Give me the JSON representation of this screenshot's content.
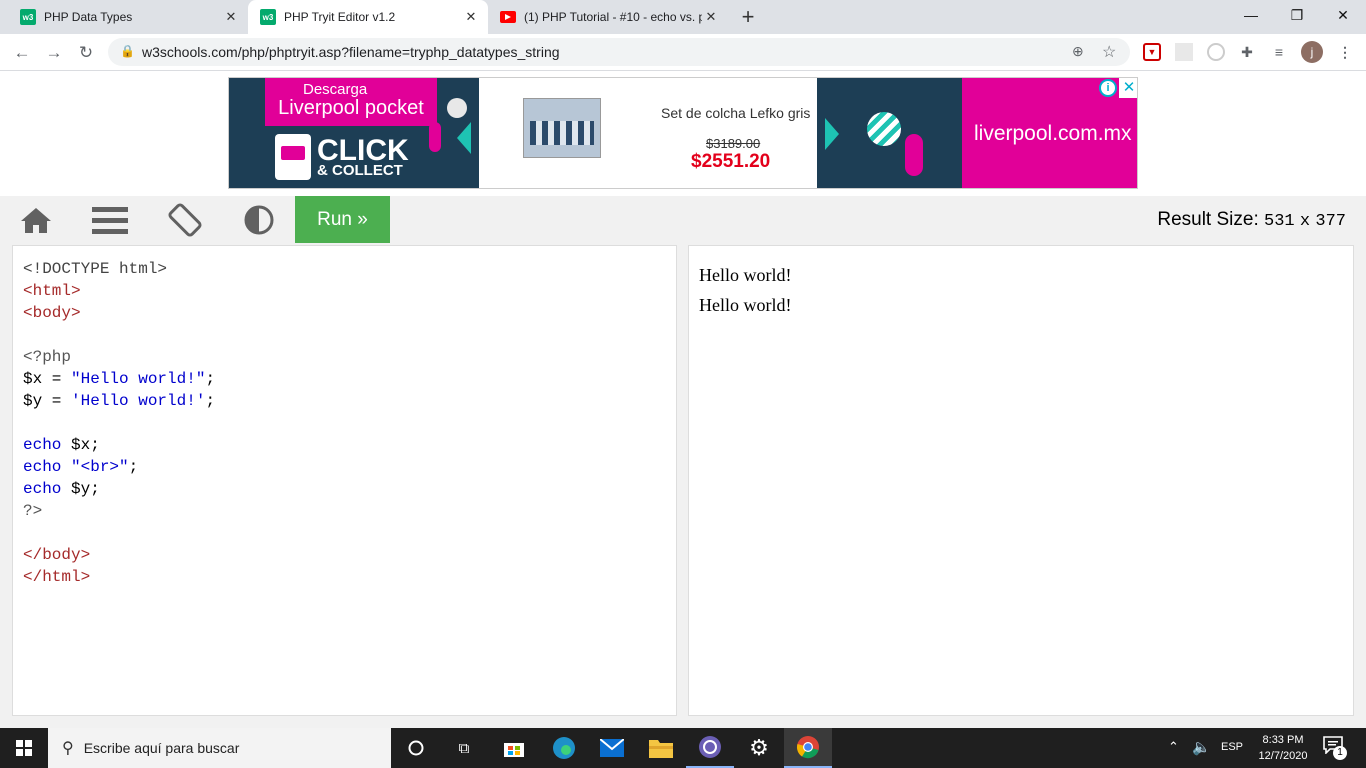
{
  "browser": {
    "tabs": [
      {
        "title": "PHP Data Types",
        "icon": "w3schools-icon"
      },
      {
        "title": "PHP Tryit Editor v1.2",
        "icon": "w3schools-icon"
      },
      {
        "title": "(1) PHP Tutorial - #10 - echo vs. p",
        "icon": "youtube-icon"
      }
    ],
    "new_tab": "+",
    "url": "w3schools.com/php/phptryit.asp?filename=tryphp_datatypes_string",
    "profile_initial": "j"
  },
  "ad": {
    "left_top": "Descarga",
    "left_brand": "Liverpool pocket",
    "left_click": "CLICK",
    "left_collect": "& COLLECT",
    "product_title": "Set de colcha Lefko gris",
    "old_price": "$3189.00",
    "new_price": "$2551.20",
    "domain": "liverpool.com.mx",
    "colors": {
      "navy": "#1d3e55",
      "pink": "#e10098",
      "price_red": "#e3001b"
    }
  },
  "w3toolbar": {
    "run_label": "Run »",
    "result_label": "Result Size:",
    "result_width": "531",
    "result_x": "x",
    "result_height": "377"
  },
  "editor": {
    "lines": [
      [
        {
          "t": "<!DOCTYPE html>",
          "c": "#444"
        }
      ],
      [
        {
          "t": "<html>",
          "c": "#a52a2a"
        }
      ],
      [
        {
          "t": "<body>",
          "c": "#a52a2a"
        }
      ],
      [
        {
          "t": "",
          "c": "#000"
        }
      ],
      [
        {
          "t": "<?php",
          "c": "#555"
        }
      ],
      [
        {
          "t": "$x",
          "c": "#000"
        },
        {
          "t": " = ",
          "c": "#000"
        },
        {
          "t": "\"Hello world!\"",
          "c": "#0000cd"
        },
        {
          "t": ";",
          "c": "#000"
        }
      ],
      [
        {
          "t": "$y",
          "c": "#000"
        },
        {
          "t": " = ",
          "c": "#000"
        },
        {
          "t": "'Hello world!'",
          "c": "#0000cd"
        },
        {
          "t": ";",
          "c": "#000"
        }
      ],
      [
        {
          "t": "",
          "c": "#000"
        }
      ],
      [
        {
          "t": "echo",
          "c": "#0000cd"
        },
        {
          "t": " $x;",
          "c": "#000"
        }
      ],
      [
        {
          "t": "echo",
          "c": "#0000cd"
        },
        {
          "t": " ",
          "c": "#000"
        },
        {
          "t": "\"<br>\"",
          "c": "#0000cd"
        },
        {
          "t": ";",
          "c": "#000"
        }
      ],
      [
        {
          "t": "echo",
          "c": "#0000cd"
        },
        {
          "t": " $y;",
          "c": "#000"
        }
      ],
      [
        {
          "t": "?>",
          "c": "#555"
        }
      ],
      [
        {
          "t": "",
          "c": "#000"
        }
      ],
      [
        {
          "t": "</body>",
          "c": "#a52a2a"
        }
      ],
      [
        {
          "t": "</html>",
          "c": "#a52a2a"
        }
      ]
    ]
  },
  "result": {
    "lines": [
      "Hello world!",
      "Hello world!"
    ]
  },
  "taskbar": {
    "search_placeholder": "Escribe aquí para buscar",
    "lang": "ESP",
    "time": "8:33 PM",
    "date": "12/7/2020",
    "notif_count": "1"
  }
}
